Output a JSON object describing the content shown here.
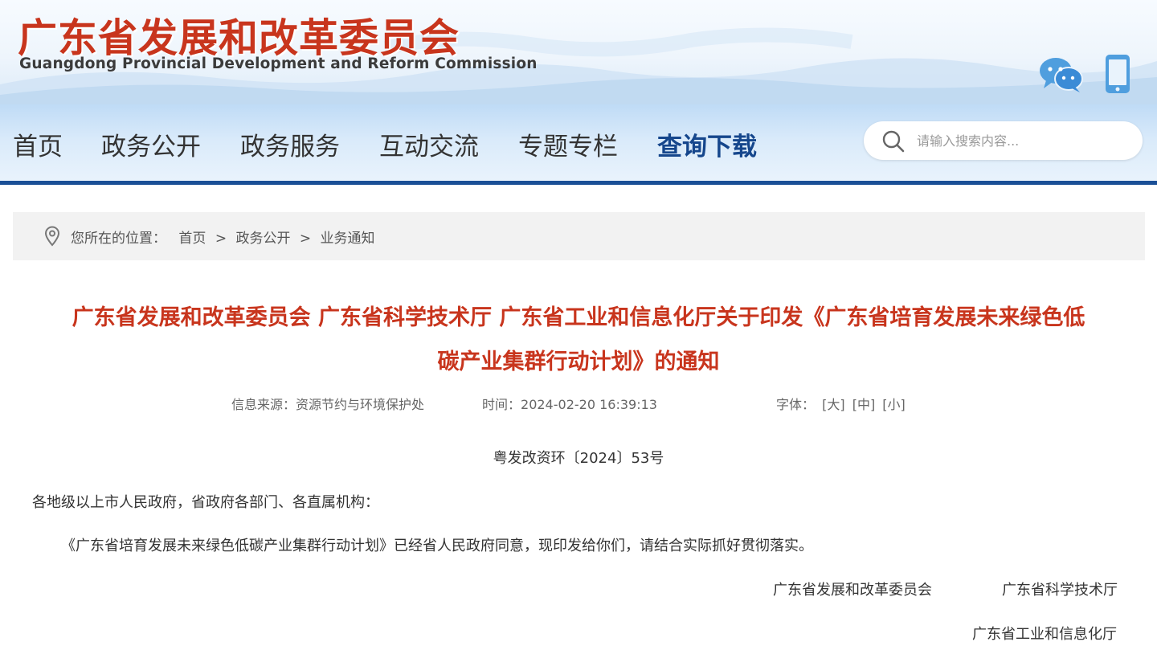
{
  "header": {
    "logo_cn": "广东省发展和改革委员会",
    "logo_en": "Guangdong Provincial Development and Reform Commission",
    "brand_color": "#c8351d",
    "icons": [
      "wechat-icon",
      "mobile-icon"
    ]
  },
  "nav": {
    "items": [
      {
        "label": "首页",
        "active": false
      },
      {
        "label": "政务公开",
        "active": false
      },
      {
        "label": "政务服务",
        "active": false
      },
      {
        "label": "互动交流",
        "active": false
      },
      {
        "label": "专题专栏",
        "active": false
      },
      {
        "label": "查询下载",
        "active": true
      }
    ],
    "active_color": "#15468c",
    "search_placeholder": "请输入搜索内容..."
  },
  "breadcrumb": {
    "prefix": "您所在的位置：",
    "items": [
      "首页",
      "政务公开",
      "业务通知"
    ],
    "separator": ">"
  },
  "article": {
    "title_line1": "广东省发展和改革委员会 广东省科学技术厅 广东省工业和信息化厅关于印发《广东省培育发展未来绿色低",
    "title_line2": "碳产业集群行动计划》的通知",
    "source_label": "信息来源：",
    "source": "资源节约与环境保护处",
    "time_label": "时间：",
    "time": "2024-02-20 16:39:13",
    "font_label": "字体：",
    "font_options": [
      "[大]",
      "[中]",
      "[小]"
    ],
    "doc_number": "粤发改资环〔2024〕53号",
    "recipient": "各地级以上市人民政府，省政府各部门、各直属机构：",
    "body": "《广东省培育发展未来绿色低碳产业集群行动计划》已经省人民政府同意，现印发给你们，请结合实际抓好贯彻落实。",
    "signatures": [
      "广东省发展和改革委员会",
      "广东省科学技术厅",
      "广东省工业和信息化厅"
    ]
  }
}
